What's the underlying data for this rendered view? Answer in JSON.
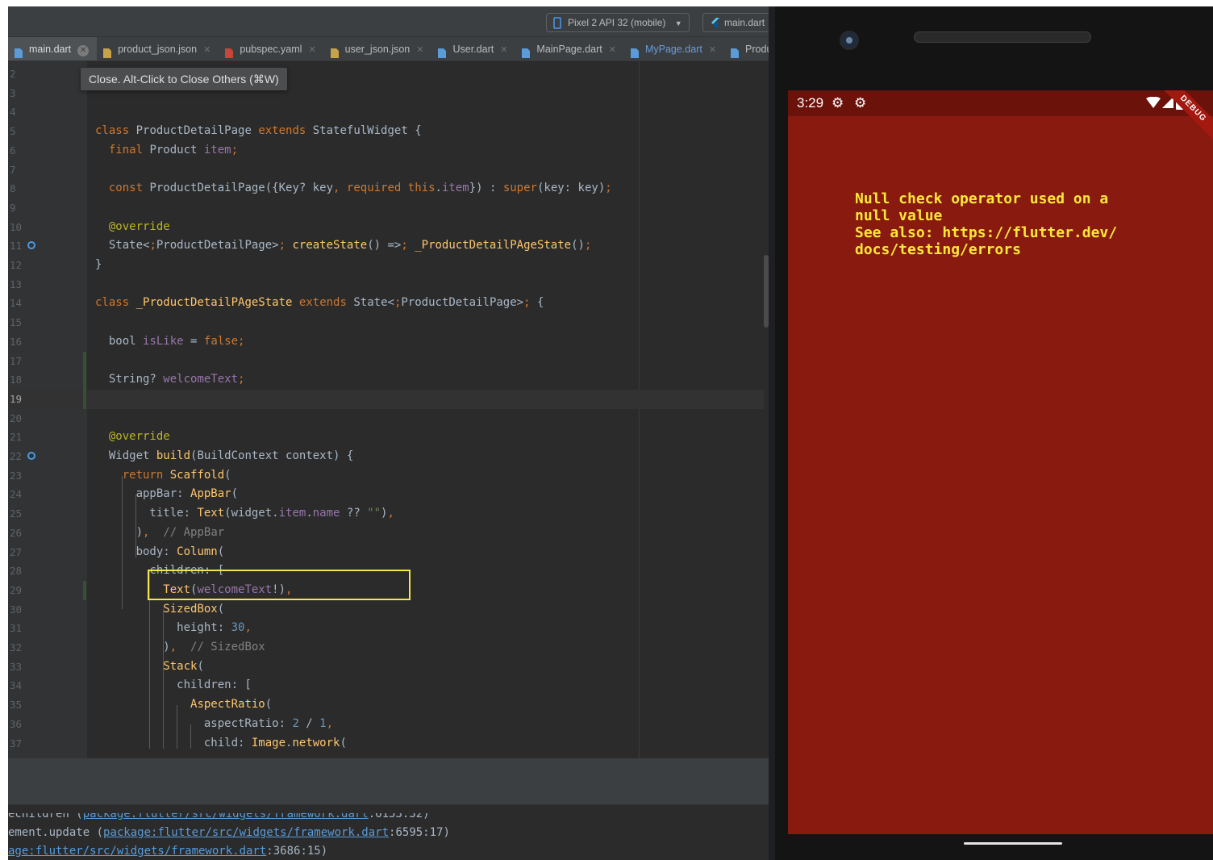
{
  "toolbar": {
    "device": "Pixel 2 API 32 (mobile)",
    "run_config": "main.dart"
  },
  "tabs": [
    {
      "label": "main.dart",
      "active": true
    },
    {
      "label": "product_json.json"
    },
    {
      "label": "pubspec.yaml"
    },
    {
      "label": "user_json.json"
    },
    {
      "label": "User.dart"
    },
    {
      "label": "MainPage.dart"
    },
    {
      "label": "MyPage.dart",
      "modified": true
    },
    {
      "label": "Produ"
    }
  ],
  "tooltip": "Close. Alt-Click to Close Others (⌘W)",
  "editor": {
    "current_line": 19,
    "lines": [
      {
        "n": "2",
        "t": ""
      },
      {
        "n": "3",
        "t": ""
      },
      {
        "n": "4",
        "t": ""
      },
      {
        "n": "5",
        "t": "class ProductDetailPage extends StatefulWidget {"
      },
      {
        "n": "6",
        "t": "  final Product item;"
      },
      {
        "n": "7",
        "t": ""
      },
      {
        "n": "8",
        "t": "  const ProductDetailPage({Key? key, required this.item}) : super(key: key);"
      },
      {
        "n": "9",
        "t": ""
      },
      {
        "n": "10",
        "t": "  @override"
      },
      {
        "n": "11",
        "t": "  State<ProductDetailPage> createState() => _ProductDetailPAgeState();"
      },
      {
        "n": "12",
        "t": "}"
      },
      {
        "n": "13",
        "t": ""
      },
      {
        "n": "14",
        "t": "class _ProductDetailPAgeState extends State<ProductDetailPage> {"
      },
      {
        "n": "15",
        "t": ""
      },
      {
        "n": "16",
        "t": "  bool isLike = false;"
      },
      {
        "n": "17",
        "t": ""
      },
      {
        "n": "18",
        "t": "  String? welcomeText;"
      },
      {
        "n": "19",
        "t": ""
      },
      {
        "n": "20",
        "t": ""
      },
      {
        "n": "21",
        "t": "  @override"
      },
      {
        "n": "22",
        "t": "  Widget build(BuildContext context) {"
      },
      {
        "n": "23",
        "t": "    return Scaffold("
      },
      {
        "n": "24",
        "t": "      appBar: AppBar("
      },
      {
        "n": "25",
        "t": "        title: Text(widget.item.name ?? \"\"),"
      },
      {
        "n": "26",
        "t": "      ),  // AppBar"
      },
      {
        "n": "27",
        "t": "      body: Column("
      },
      {
        "n": "28",
        "t": "        children: ["
      },
      {
        "n": "29",
        "t": "          Text(welcomeText!),"
      },
      {
        "n": "30",
        "t": "          SizedBox("
      },
      {
        "n": "31",
        "t": "            height: 30,"
      },
      {
        "n": "32",
        "t": "          ),  // SizedBox"
      },
      {
        "n": "33",
        "t": "          Stack("
      },
      {
        "n": "34",
        "t": "            children: ["
      },
      {
        "n": "35",
        "t": "              AspectRatio("
      },
      {
        "n": "36",
        "t": "                aspectRatio: 2 / 1,"
      },
      {
        "n": "37",
        "t": "                child: Image.network("
      }
    ]
  },
  "console": {
    "line1_prefix": "ement.update (",
    "line1_link": "package:flutter/src/widgets/framework.dart",
    "line1_suffix": ":6595:17)",
    "line2_link": "age:flutter/src/widgets/framework.dart",
    "line2_suffix": ":3686:15)"
  },
  "phone": {
    "time": "3:29",
    "debug_banner": "DEBUG",
    "error_message": "Null check operator used on a null value\nSee also: https://flutter.dev/docs/testing/errors",
    "colors": {
      "screen_bg": "#881a10",
      "error_text": "#ffe838"
    }
  }
}
